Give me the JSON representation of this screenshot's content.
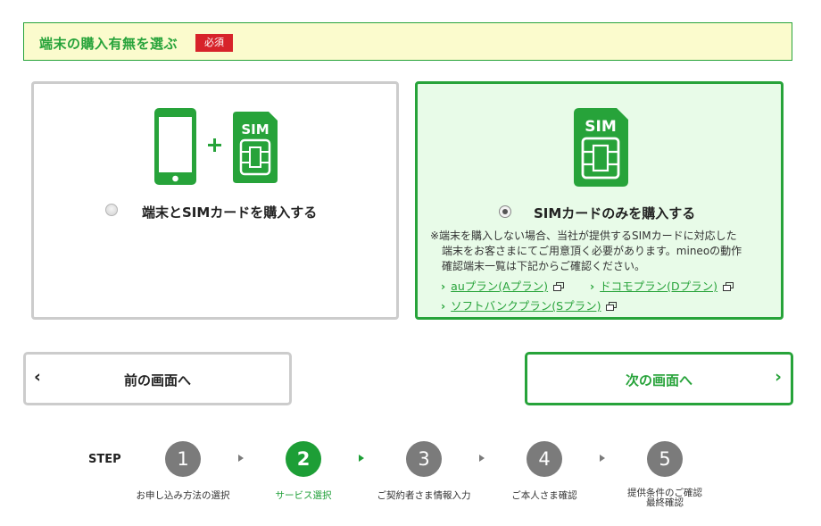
{
  "header": {
    "title": "端末の購入有無を選ぶ",
    "badge": "必須"
  },
  "options": [
    {
      "label": "端末とSIMカードを購入する",
      "selected": false,
      "icons": [
        "smartphone-icon",
        "plus-icon",
        "sim-card-icon"
      ]
    },
    {
      "label": "SIMカードのみを購入する",
      "selected": true,
      "icons": [
        "sim-card-icon"
      ],
      "note": [
        "※端末を購入しない場合、当社が提供するSIMカードに対応した",
        "端末をお客さまにてご用意頂く必要があります。mineoの動作",
        "確認端末一覧は下記からご確認ください。"
      ],
      "links": [
        "auプラン(Aプラン)",
        "ドコモプラン(Dプラン)",
        "ソフトバンクプラン(Sプラン)"
      ]
    }
  ],
  "nav": {
    "prev": "前の画面へ",
    "next": "次の画面へ"
  },
  "steps": {
    "label": "STEP",
    "items": [
      {
        "number": "1",
        "text": "お申し込み方法の選択",
        "active": false
      },
      {
        "number": "2",
        "text": "サービス選択",
        "active": true
      },
      {
        "number": "3",
        "text": "ご契約者さま情報入力",
        "active": false
      },
      {
        "number": "4",
        "text": "ご本人さま確認",
        "active": false
      },
      {
        "number": "5",
        "text": "提供条件のご確認",
        "text2": "最終確認",
        "active": false
      }
    ]
  },
  "colors": {
    "accent": "#27a33a",
    "required": "#d7232a",
    "header_bg": "#fbfbcd",
    "selected_bg": "#e8fbe8",
    "step_inactive": "#7b7b7b"
  }
}
